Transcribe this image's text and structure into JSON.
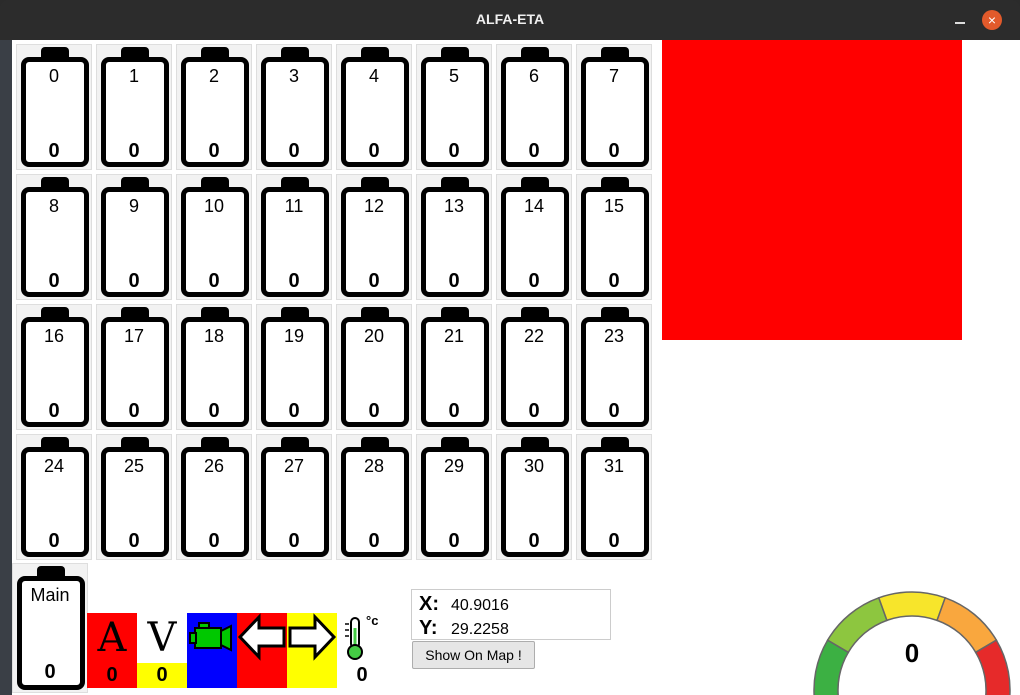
{
  "window": {
    "title": "ALFA-ETA",
    "minimize_glyph": "—",
    "close_glyph": "×"
  },
  "batteries": [
    {
      "id": "0",
      "value": "0"
    },
    {
      "id": "1",
      "value": "0"
    },
    {
      "id": "2",
      "value": "0"
    },
    {
      "id": "3",
      "value": "0"
    },
    {
      "id": "4",
      "value": "0"
    },
    {
      "id": "5",
      "value": "0"
    },
    {
      "id": "6",
      "value": "0"
    },
    {
      "id": "7",
      "value": "0"
    },
    {
      "id": "8",
      "value": "0"
    },
    {
      "id": "9",
      "value": "0"
    },
    {
      "id": "10",
      "value": "0"
    },
    {
      "id": "11",
      "value": "0"
    },
    {
      "id": "12",
      "value": "0"
    },
    {
      "id": "13",
      "value": "0"
    },
    {
      "id": "14",
      "value": "0"
    },
    {
      "id": "15",
      "value": "0"
    },
    {
      "id": "16",
      "value": "0"
    },
    {
      "id": "17",
      "value": "0"
    },
    {
      "id": "18",
      "value": "0"
    },
    {
      "id": "19",
      "value": "0"
    },
    {
      "id": "20",
      "value": "0"
    },
    {
      "id": "21",
      "value": "0"
    },
    {
      "id": "22",
      "value": "0"
    },
    {
      "id": "23",
      "value": "0"
    },
    {
      "id": "24",
      "value": "0"
    },
    {
      "id": "25",
      "value": "0"
    },
    {
      "id": "26",
      "value": "0"
    },
    {
      "id": "27",
      "value": "0"
    },
    {
      "id": "28",
      "value": "0"
    },
    {
      "id": "29",
      "value": "0"
    },
    {
      "id": "30",
      "value": "0"
    },
    {
      "id": "31",
      "value": "0"
    }
  ],
  "main_battery": {
    "label": "Main",
    "value": "0"
  },
  "status": {
    "current": {
      "letter": "A",
      "value": "0",
      "color": "#ff0000"
    },
    "voltage": {
      "letter": "V",
      "value": "0",
      "color": "#ffff00"
    },
    "engine": {
      "icon": "engine-icon",
      "color": "#0000ff",
      "icon_color": "#00c800"
    },
    "left_signal": {
      "icon": "arrow-left-icon",
      "color": "#ff0000"
    },
    "right_signal": {
      "icon": "arrow-right-icon",
      "color": "#ffff00"
    },
    "temperature": {
      "icon": "thermometer-icon",
      "unit": "°c",
      "value": "0",
      "icon_color": "#44cc44"
    }
  },
  "position": {
    "x_label": "X:",
    "x_value": "40.9016",
    "y_label": "Y:",
    "y_value": "29.2258"
  },
  "show_on_map_label": "Show On Map !",
  "gauge": {
    "value": "0",
    "colors": [
      "#3cb043",
      "#8dc63f",
      "#f7e52b",
      "#f9a73e",
      "#e62a2a"
    ]
  },
  "indicator_color": "#ff0000"
}
